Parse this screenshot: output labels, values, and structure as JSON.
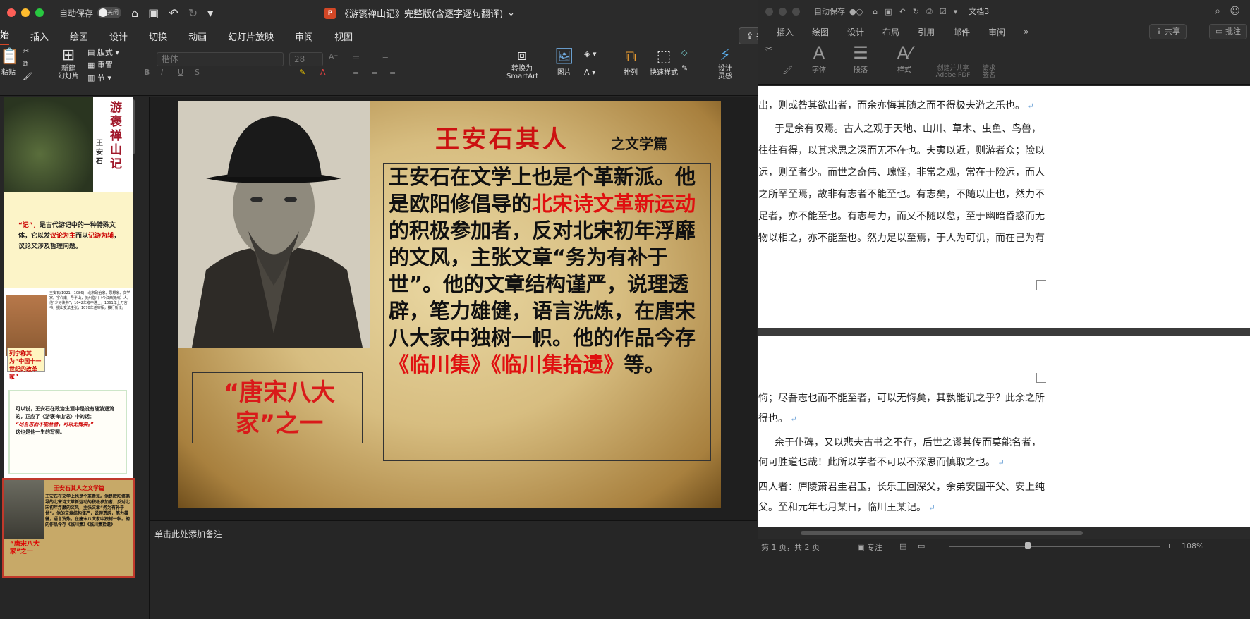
{
  "ppt": {
    "autosave_label": "自动保存",
    "autosave_state": "关闭",
    "title": "《游褒禅山记》完整版(含逐字逐句翻译)",
    "menu": [
      "始",
      "插入",
      "绘图",
      "设计",
      "切换",
      "动画",
      "幻灯片放映",
      "审阅",
      "视图"
    ],
    "share_label": "共享",
    "comment_label": "批注",
    "ribbon": {
      "paste": "粘贴",
      "new_slide": "新建\n幻灯片",
      "layout": "版式",
      "reset": "重置",
      "section": "节",
      "font_placeholder": "楷体",
      "font_size": "28",
      "convert_smartart": "转换为\nSmartArt",
      "picture": "图片",
      "arrange": "排列",
      "quick_styles": "快速样式",
      "designer": "设计\n灵感"
    },
    "notes_placeholder": "单击此处添加备注",
    "thumbnails": {
      "t1_title": "游褒禅山记",
      "t1_author": "王安石",
      "t2_text_a": "“记”，",
      "t2_text_b": "是古代游记中的一种特殊文体，它以发",
      "t2_text_c": "议论为主",
      "t2_text_d": "而以",
      "t2_text_e": "记游为辅",
      "t2_text_f": "，议论又涉及哲理问题。",
      "t3_text": "王安石(1021—1086)，北宋政治家、思想家、文学家。字介甫，号半山，抚州临川（今江西抚州）人。他“少好读书”，1042年考中进士，1061年上万言书，提出变法主张，1070年任宰相，推行新法。",
      "t3_red": "列宁称其为“中国十一世纪的改革家”",
      "t4_text_a": "可以说，王安石在政治生涯中是没有随波逐流的，正应了《游褒禅山记》中的话：",
      "t4_text_b": "“尽吾志而不能至者，可以无悔矣。”",
      "t4_text_c": "这也是他一生的写照。",
      "t5_title": "王安石其人之文学篇",
      "t5_text": "王安石在文学上也是个革新派。他是欧阳修倡导的北宋诗文革新运动的积极参加者，反对北宋初年浮靡的文风，主张文章“务为有补于世”。他的文章结构谨严，说理透辟，笔力雄健，语言洗炼，在唐宋八大家中独树一帜。他的作品今存《临川集》《临川集拾遗》",
      "t5_red": "“唐宋八大家”之一"
    },
    "slide": {
      "title": "王安石其人",
      "subtitle": "之文学篇",
      "body_1": "王安石在文学上也是个革新派。他是欧阳修倡导的",
      "body_red_1": "北宋诗文革新运动",
      "body_2": "的积极参加者，反对北宋初年浮靡的文风，主张文章“务为有补于世”。他的文章结构谨严，说理透辟，笔力雄健，语言洗炼，在唐宋八大家中独树一帜。他的作品今存",
      "body_red_2": "《临川集》《临川集拾遗》",
      "body_3": "等。",
      "callout": "“唐宋八大家”之一"
    }
  },
  "word": {
    "autosave_label": "自动保存",
    "title": "文档3",
    "menu": [
      "插入",
      "绘图",
      "设计",
      "布局",
      "引用",
      "邮件",
      "审阅"
    ],
    "share_label": "共享",
    "comment_label": "批注",
    "ribbon": {
      "font": "字体",
      "paragraph": "段落",
      "styles": "样式",
      "adobe": "创建并共享\nAdobe PDF",
      "sign": "请求\n签名"
    },
    "page1_lines": [
      "出，则或咎其欲出者，而余亦悔其随之而不得极夫游之乐也。",
      "于是余有叹焉。古人之观于天地、山川、草木、虫鱼、鸟兽，",
      "往往有得，以其求思之深而无不在也。夫夷以近，则游者众；险以",
      "远，则至者少。而世之奇伟、瑰怪，非常之观，常在于险远，而人",
      "之所罕至焉，故非有志者不能至也。有志矣，不随以止也，然力不",
      "足者，亦不能至也。有志与力，而又不随以怠，至于幽暗昏惑而无",
      "物以相之，亦不能至也。然力足以至焉，于人为可讥，而在己为有"
    ],
    "page2_lines": [
      "悔；尽吾志也而不能至者，可以无悔矣，其孰能讥之乎？此余之所",
      "得也。",
      "余于仆碑，又以悲夫古书之不存，后世之谬其传而莫能名者，",
      "何可胜道也哉！此所以学者不可以不深思而慎取之也。",
      "四人者：庐陵萧君圭君玉，长乐王回深父，余弟安国平父、安上纯",
      "父。至和元年七月某日，临川王某记。"
    ],
    "status_page": "第 1 页，共 2 页",
    "status_focus": "专注",
    "zoom": "108%"
  }
}
